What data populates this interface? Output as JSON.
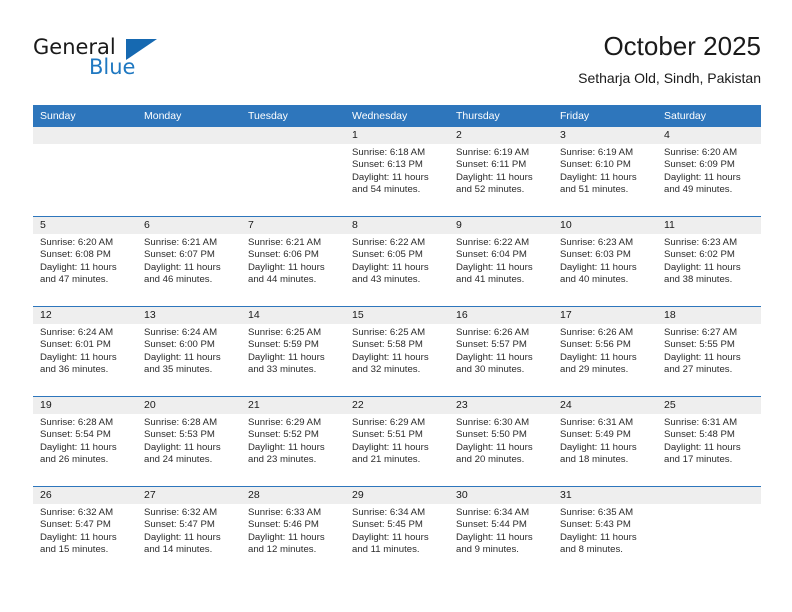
{
  "brand": {
    "name_part1": "General",
    "name_part2": "Blue",
    "flag_icon": "blue-triangle-flag-icon",
    "accent_color": "#1f78c1"
  },
  "header": {
    "title": "October 2025",
    "subtitle": "Setharja Old, Sindh, Pakistan"
  },
  "calendar": {
    "header_bg": "#2e76bc",
    "datestrip_bg": "#eeeeee",
    "weekday_headers": [
      "Sunday",
      "Monday",
      "Tuesday",
      "Wednesday",
      "Thursday",
      "Friday",
      "Saturday"
    ],
    "weeks": [
      [
        {
          "day": "",
          "sunrise": "",
          "sunset": "",
          "daylight_line1": "",
          "daylight_line2": "",
          "empty": true
        },
        {
          "day": "",
          "sunrise": "",
          "sunset": "",
          "daylight_line1": "",
          "daylight_line2": "",
          "empty": true
        },
        {
          "day": "",
          "sunrise": "",
          "sunset": "",
          "daylight_line1": "",
          "daylight_line2": "",
          "empty": true
        },
        {
          "day": "1",
          "sunrise": "Sunrise: 6:18 AM",
          "sunset": "Sunset: 6:13 PM",
          "daylight_line1": "Daylight: 11 hours",
          "daylight_line2": "and 54 minutes.",
          "empty": false
        },
        {
          "day": "2",
          "sunrise": "Sunrise: 6:19 AM",
          "sunset": "Sunset: 6:11 PM",
          "daylight_line1": "Daylight: 11 hours",
          "daylight_line2": "and 52 minutes.",
          "empty": false
        },
        {
          "day": "3",
          "sunrise": "Sunrise: 6:19 AM",
          "sunset": "Sunset: 6:10 PM",
          "daylight_line1": "Daylight: 11 hours",
          "daylight_line2": "and 51 minutes.",
          "empty": false
        },
        {
          "day": "4",
          "sunrise": "Sunrise: 6:20 AM",
          "sunset": "Sunset: 6:09 PM",
          "daylight_line1": "Daylight: 11 hours",
          "daylight_line2": "and 49 minutes.",
          "empty": false
        }
      ],
      [
        {
          "day": "5",
          "sunrise": "Sunrise: 6:20 AM",
          "sunset": "Sunset: 6:08 PM",
          "daylight_line1": "Daylight: 11 hours",
          "daylight_line2": "and 47 minutes.",
          "empty": false
        },
        {
          "day": "6",
          "sunrise": "Sunrise: 6:21 AM",
          "sunset": "Sunset: 6:07 PM",
          "daylight_line1": "Daylight: 11 hours",
          "daylight_line2": "and 46 minutes.",
          "empty": false
        },
        {
          "day": "7",
          "sunrise": "Sunrise: 6:21 AM",
          "sunset": "Sunset: 6:06 PM",
          "daylight_line1": "Daylight: 11 hours",
          "daylight_line2": "and 44 minutes.",
          "empty": false
        },
        {
          "day": "8",
          "sunrise": "Sunrise: 6:22 AM",
          "sunset": "Sunset: 6:05 PM",
          "daylight_line1": "Daylight: 11 hours",
          "daylight_line2": "and 43 minutes.",
          "empty": false
        },
        {
          "day": "9",
          "sunrise": "Sunrise: 6:22 AM",
          "sunset": "Sunset: 6:04 PM",
          "daylight_line1": "Daylight: 11 hours",
          "daylight_line2": "and 41 minutes.",
          "empty": false
        },
        {
          "day": "10",
          "sunrise": "Sunrise: 6:23 AM",
          "sunset": "Sunset: 6:03 PM",
          "daylight_line1": "Daylight: 11 hours",
          "daylight_line2": "and 40 minutes.",
          "empty": false
        },
        {
          "day": "11",
          "sunrise": "Sunrise: 6:23 AM",
          "sunset": "Sunset: 6:02 PM",
          "daylight_line1": "Daylight: 11 hours",
          "daylight_line2": "and 38 minutes.",
          "empty": false
        }
      ],
      [
        {
          "day": "12",
          "sunrise": "Sunrise: 6:24 AM",
          "sunset": "Sunset: 6:01 PM",
          "daylight_line1": "Daylight: 11 hours",
          "daylight_line2": "and 36 minutes.",
          "empty": false
        },
        {
          "day": "13",
          "sunrise": "Sunrise: 6:24 AM",
          "sunset": "Sunset: 6:00 PM",
          "daylight_line1": "Daylight: 11 hours",
          "daylight_line2": "and 35 minutes.",
          "empty": false
        },
        {
          "day": "14",
          "sunrise": "Sunrise: 6:25 AM",
          "sunset": "Sunset: 5:59 PM",
          "daylight_line1": "Daylight: 11 hours",
          "daylight_line2": "and 33 minutes.",
          "empty": false
        },
        {
          "day": "15",
          "sunrise": "Sunrise: 6:25 AM",
          "sunset": "Sunset: 5:58 PM",
          "daylight_line1": "Daylight: 11 hours",
          "daylight_line2": "and 32 minutes.",
          "empty": false
        },
        {
          "day": "16",
          "sunrise": "Sunrise: 6:26 AM",
          "sunset": "Sunset: 5:57 PM",
          "daylight_line1": "Daylight: 11 hours",
          "daylight_line2": "and 30 minutes.",
          "empty": false
        },
        {
          "day": "17",
          "sunrise": "Sunrise: 6:26 AM",
          "sunset": "Sunset: 5:56 PM",
          "daylight_line1": "Daylight: 11 hours",
          "daylight_line2": "and 29 minutes.",
          "empty": false
        },
        {
          "day": "18",
          "sunrise": "Sunrise: 6:27 AM",
          "sunset": "Sunset: 5:55 PM",
          "daylight_line1": "Daylight: 11 hours",
          "daylight_line2": "and 27 minutes.",
          "empty": false
        }
      ],
      [
        {
          "day": "19",
          "sunrise": "Sunrise: 6:28 AM",
          "sunset": "Sunset: 5:54 PM",
          "daylight_line1": "Daylight: 11 hours",
          "daylight_line2": "and 26 minutes.",
          "empty": false
        },
        {
          "day": "20",
          "sunrise": "Sunrise: 6:28 AM",
          "sunset": "Sunset: 5:53 PM",
          "daylight_line1": "Daylight: 11 hours",
          "daylight_line2": "and 24 minutes.",
          "empty": false
        },
        {
          "day": "21",
          "sunrise": "Sunrise: 6:29 AM",
          "sunset": "Sunset: 5:52 PM",
          "daylight_line1": "Daylight: 11 hours",
          "daylight_line2": "and 23 minutes.",
          "empty": false
        },
        {
          "day": "22",
          "sunrise": "Sunrise: 6:29 AM",
          "sunset": "Sunset: 5:51 PM",
          "daylight_line1": "Daylight: 11 hours",
          "daylight_line2": "and 21 minutes.",
          "empty": false
        },
        {
          "day": "23",
          "sunrise": "Sunrise: 6:30 AM",
          "sunset": "Sunset: 5:50 PM",
          "daylight_line1": "Daylight: 11 hours",
          "daylight_line2": "and 20 minutes.",
          "empty": false
        },
        {
          "day": "24",
          "sunrise": "Sunrise: 6:31 AM",
          "sunset": "Sunset: 5:49 PM",
          "daylight_line1": "Daylight: 11 hours",
          "daylight_line2": "and 18 minutes.",
          "empty": false
        },
        {
          "day": "25",
          "sunrise": "Sunrise: 6:31 AM",
          "sunset": "Sunset: 5:48 PM",
          "daylight_line1": "Daylight: 11 hours",
          "daylight_line2": "and 17 minutes.",
          "empty": false
        }
      ],
      [
        {
          "day": "26",
          "sunrise": "Sunrise: 6:32 AM",
          "sunset": "Sunset: 5:47 PM",
          "daylight_line1": "Daylight: 11 hours",
          "daylight_line2": "and 15 minutes.",
          "empty": false
        },
        {
          "day": "27",
          "sunrise": "Sunrise: 6:32 AM",
          "sunset": "Sunset: 5:47 PM",
          "daylight_line1": "Daylight: 11 hours",
          "daylight_line2": "and 14 minutes.",
          "empty": false
        },
        {
          "day": "28",
          "sunrise": "Sunrise: 6:33 AM",
          "sunset": "Sunset: 5:46 PM",
          "daylight_line1": "Daylight: 11 hours",
          "daylight_line2": "and 12 minutes.",
          "empty": false
        },
        {
          "day": "29",
          "sunrise": "Sunrise: 6:34 AM",
          "sunset": "Sunset: 5:45 PM",
          "daylight_line1": "Daylight: 11 hours",
          "daylight_line2": "and 11 minutes.",
          "empty": false
        },
        {
          "day": "30",
          "sunrise": "Sunrise: 6:34 AM",
          "sunset": "Sunset: 5:44 PM",
          "daylight_line1": "Daylight: 11 hours",
          "daylight_line2": "and 9 minutes.",
          "empty": false
        },
        {
          "day": "31",
          "sunrise": "Sunrise: 6:35 AM",
          "sunset": "Sunset: 5:43 PM",
          "daylight_line1": "Daylight: 11 hours",
          "daylight_line2": "and 8 minutes.",
          "empty": false
        },
        {
          "day": "",
          "sunrise": "",
          "sunset": "",
          "daylight_line1": "",
          "daylight_line2": "",
          "empty": true
        }
      ]
    ]
  }
}
